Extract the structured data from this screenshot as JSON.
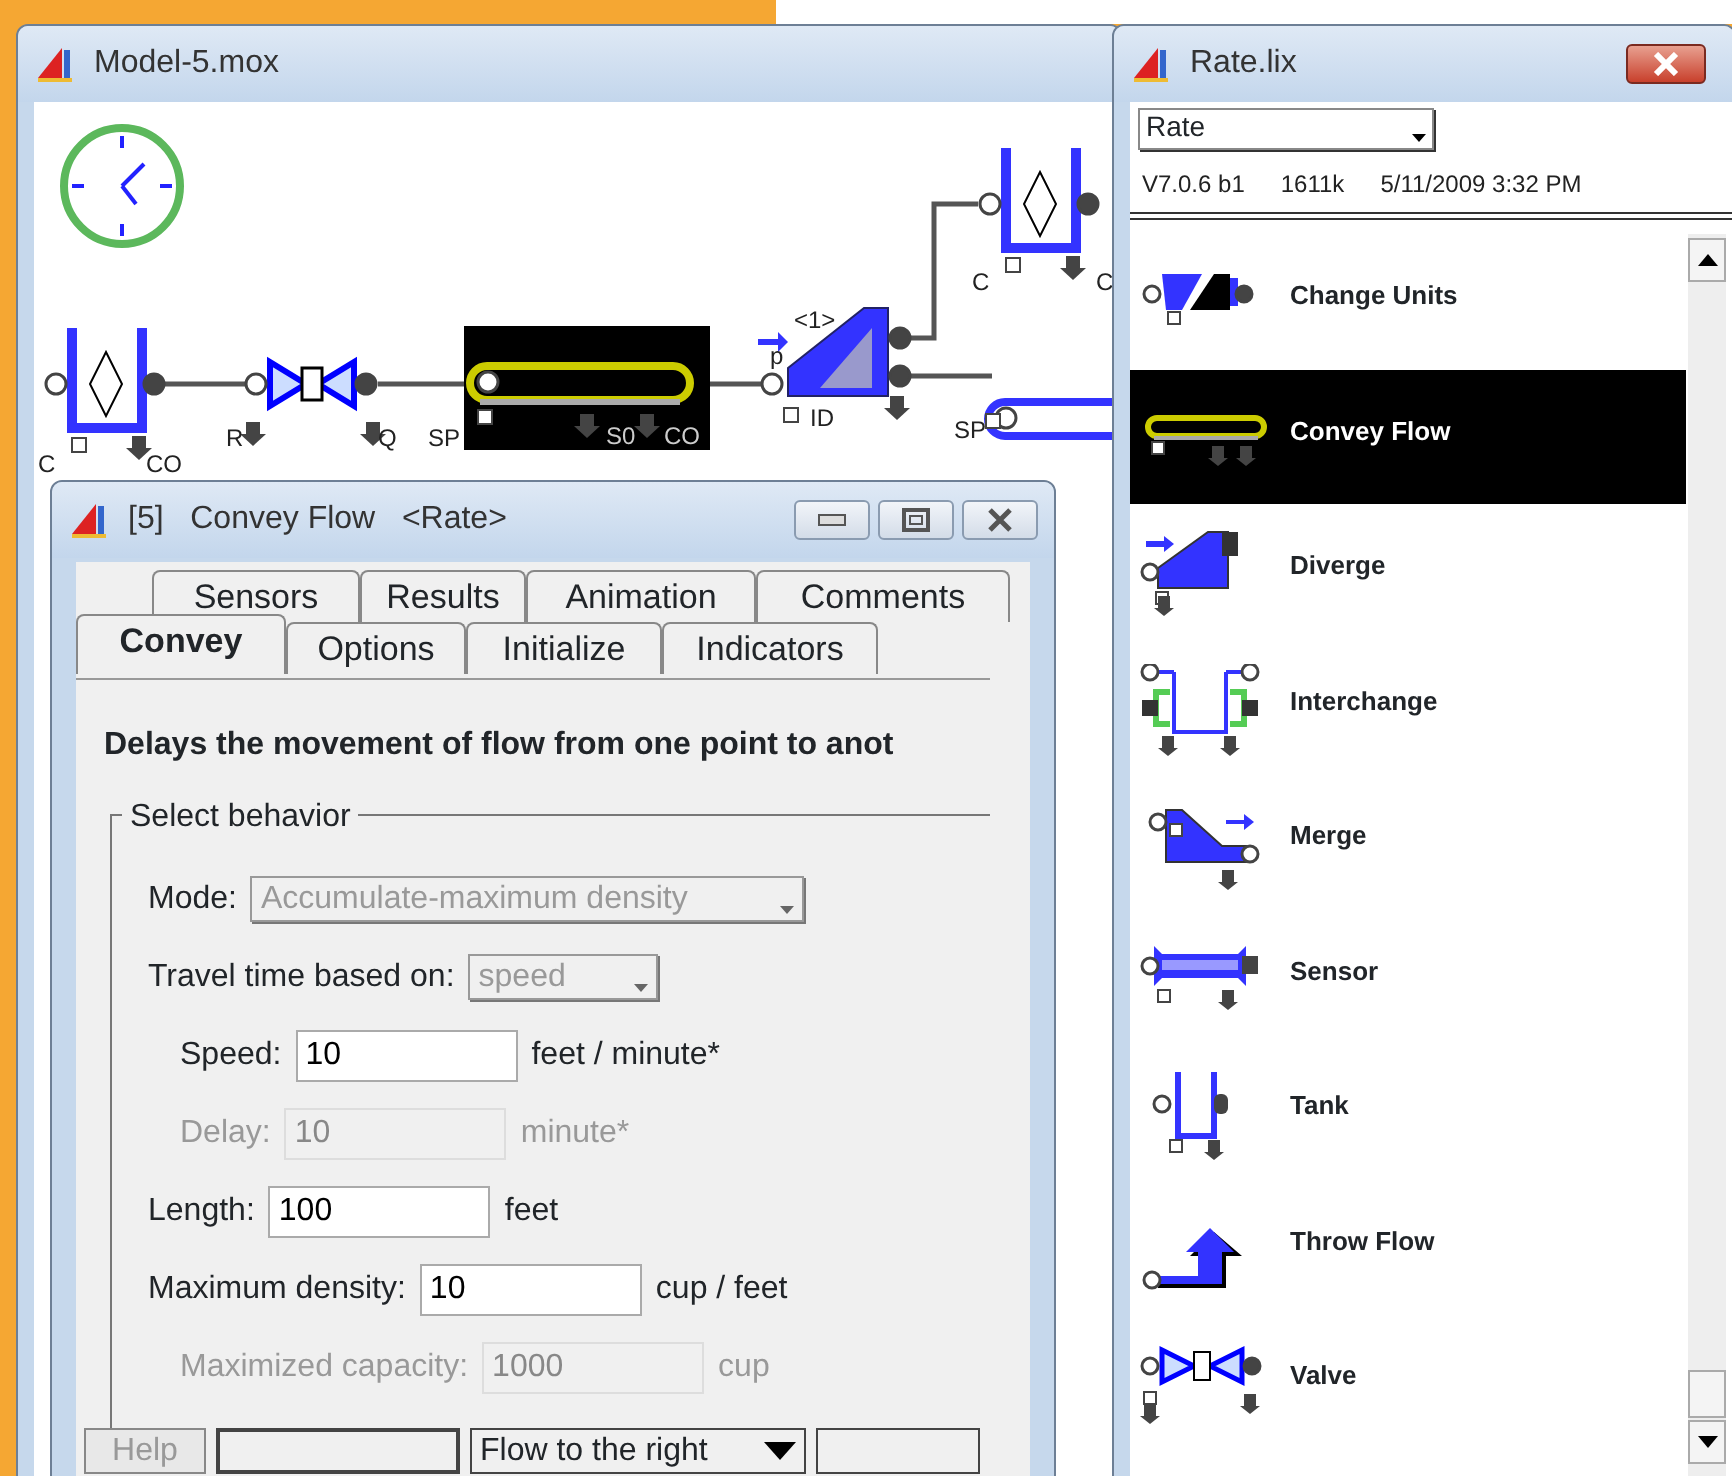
{
  "model_window": {
    "title": "Model-5.mox",
    "diagram": {
      "blocks": [
        {
          "kind": "tank",
          "selected": false,
          "labels": [
            "C",
            "CO"
          ]
        },
        {
          "kind": "valve",
          "selected": false,
          "labels": [
            "R",
            "Q"
          ]
        },
        {
          "kind": "convey",
          "selected": true,
          "labels": [
            "SP",
            "S0",
            "CO"
          ]
        },
        {
          "kind": "diverge",
          "selected": false,
          "labels": [
            "<1>",
            "p",
            "ID"
          ]
        },
        {
          "kind": "tank",
          "selected": false,
          "labels": [
            "C",
            "C"
          ]
        },
        {
          "kind": "convey",
          "selected": false,
          "labels": [
            "SP"
          ]
        }
      ]
    }
  },
  "dialog": {
    "title": "[5]   Convey Flow   <Rate>",
    "tab_rows": [
      {
        "tabs": [
          {
            "label": "Sensors",
            "selected": false
          },
          {
            "label": "Results",
            "selected": false
          },
          {
            "label": "Animation",
            "selected": false
          },
          {
            "label": "Comments",
            "selected": false
          }
        ]
      },
      {
        "tabs": [
          {
            "label": "Convey",
            "selected": true
          },
          {
            "label": "Options",
            "selected": false
          },
          {
            "label": "Initialize",
            "selected": false
          },
          {
            "label": "Indicators",
            "selected": false
          }
        ]
      }
    ],
    "description": "Delays the movement of flow from one point to anot",
    "group": {
      "title": "Select behavior",
      "fields": [
        {
          "kind": "select",
          "label": "Mode:",
          "value": "Accumulate-maximum density",
          "disabled": true
        },
        {
          "kind": "select",
          "label": "Travel time based on:",
          "value": "speed",
          "disabled": true,
          "children": [
            {
              "kind": "input",
              "label": "Speed:",
              "value": "10",
              "unit": "feet / minute*",
              "disabled": false
            },
            {
              "kind": "input",
              "label": "Delay:",
              "value": "10",
              "unit": "minute*",
              "disabled": true
            }
          ]
        },
        {
          "kind": "input",
          "label": "Length:",
          "value": "100",
          "unit": "feet",
          "disabled": false
        },
        {
          "kind": "input",
          "label": "Maximum density:",
          "value": "10",
          "unit": "cup / feet",
          "disabled": false,
          "children": [
            {
              "kind": "input",
              "label": "Maximized capacity:",
              "value": "1000",
              "unit": "cup",
              "disabled": true
            }
          ]
        }
      ]
    },
    "footer": {
      "help": {
        "label": "Help",
        "disabled": true
      },
      "flow_select": "Flow to the right"
    }
  },
  "library": {
    "title": "Rate.lix",
    "dropdown": "Rate",
    "info": [
      "V7.0.6 b1",
      "1611k",
      "5/11/2009 3:32 PM"
    ],
    "items": [
      {
        "kind": "change-units",
        "label": "Change Units",
        "selected": false
      },
      {
        "kind": "convey",
        "label": "Convey Flow",
        "selected": true
      },
      {
        "kind": "diverge",
        "label": "Diverge",
        "selected": false
      },
      {
        "kind": "interchange",
        "label": "Interchange",
        "selected": false
      },
      {
        "kind": "merge",
        "label": "Merge",
        "selected": false
      },
      {
        "kind": "sensor",
        "label": "Sensor",
        "selected": false
      },
      {
        "kind": "tank",
        "label": "Tank",
        "selected": false
      },
      {
        "kind": "throw",
        "label": "Throw Flow",
        "selected": false
      },
      {
        "kind": "valve",
        "label": "Valve",
        "selected": false
      }
    ]
  }
}
